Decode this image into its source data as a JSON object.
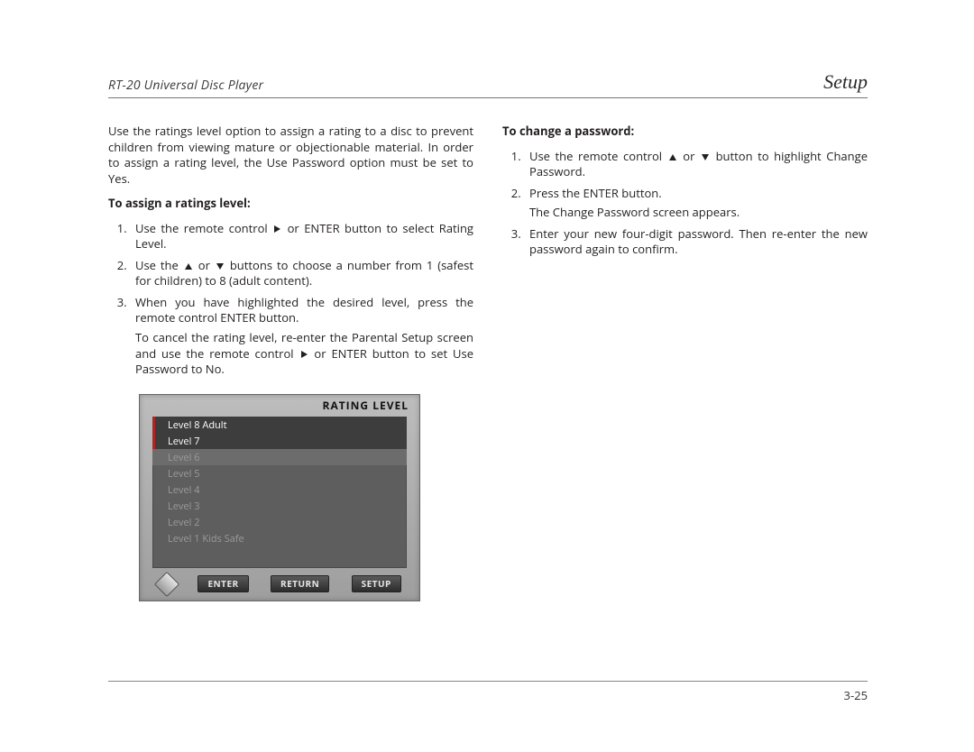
{
  "header": {
    "product": "RT-20 Universal Disc Player",
    "section": "Setup"
  },
  "left_col": {
    "intro": "Use the ratings level option to assign a rating to a disc to prevent children from viewing mature or objectionable material. In order to assign a rating level, the Use Password option must be set to Yes.",
    "heading": "To assign a ratings level:",
    "s1a": "Use the remote control ",
    "s1b": " or ENTER  button to select Rating Level.",
    "s2a": "Use the ",
    "s2b": " or ",
    "s2c": " buttons to choose a number from 1 (safest for children) to 8 (adult content).",
    "s3": "When you have highlighted the desired level, press the remote control ENTER button.",
    "cancelA": "To cancel the rating level, re-enter the Parental Setup screen and use the remote control ",
    "cancelB": " or ENTER button to set Use Password to No."
  },
  "right_col": {
    "heading": "To change a password:",
    "s1a": "Use the remote control ",
    "s1b": " or ",
    "s1c": " button to highlight Change Password.",
    "s2": "Press the ENTER button.",
    "s2sub": "The Change Password screen appears.",
    "s3": "Enter your new four-digit password. Then re-enter the new password again to confirm."
  },
  "osd": {
    "title": "RATING  LEVEL",
    "levels": [
      "Level 8 Adult",
      "Level 7",
      "Level 6",
      "Level 5",
      "Level 4",
      "Level 3",
      "Level 2",
      "Level 1 Kids Safe"
    ],
    "buttons": {
      "enter": "ENTER",
      "return": "RETURN",
      "setup": "SETUP"
    }
  },
  "footer": {
    "page": "3-25"
  }
}
